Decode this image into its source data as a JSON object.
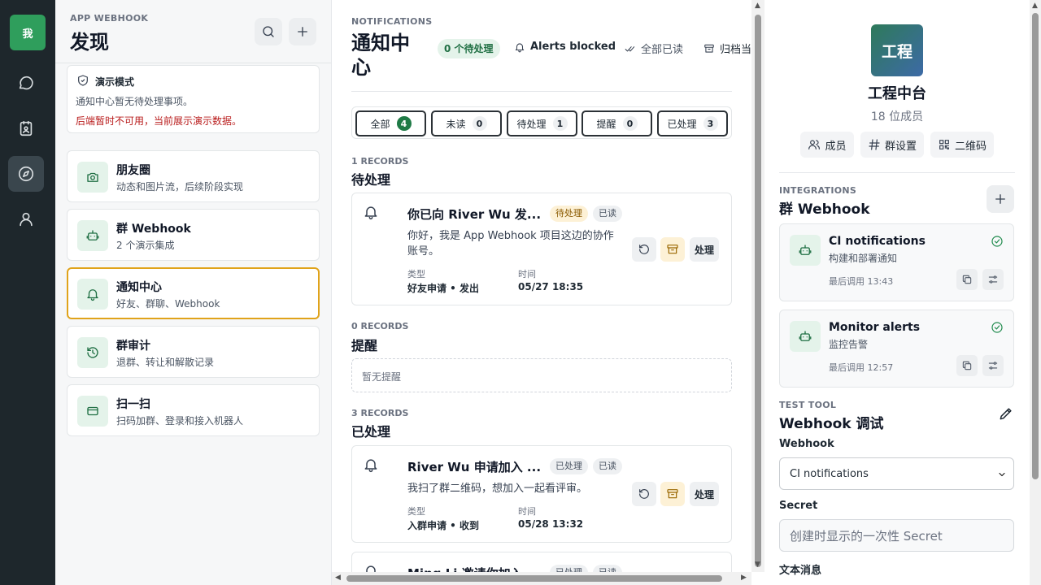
{
  "rail": {
    "me_label": "我"
  },
  "sidebar": {
    "eyebrow": "APP WEBHOOK",
    "title": "发现",
    "demo": {
      "title": "演示模式",
      "line1": "通知中心暂无待处理事项。",
      "line2": "后端暂时不可用，当前展示演示数据。"
    },
    "items": [
      {
        "title": "朋友圈",
        "subtitle": "动态和图片流，后续阶段实现"
      },
      {
        "title": "群 Webhook",
        "subtitle": "2 个演示集成"
      },
      {
        "title": "通知中心",
        "subtitle": "好友、群聊、Webhook"
      },
      {
        "title": "群审计",
        "subtitle": "退群、转让和解散记录"
      },
      {
        "title": "扫一扫",
        "subtitle": "扫码加群、登录和接入机器人"
      }
    ]
  },
  "main": {
    "eyebrow": "NOTIFICATIONS",
    "title": "通知中心",
    "pending_pill": "0 个待处理",
    "alerts_blocked": "Alerts blocked",
    "mark_all_read": "全部已读",
    "archive": "归档当前",
    "tabs": [
      {
        "label": "全部",
        "count": "4"
      },
      {
        "label": "未读",
        "count": "0"
      },
      {
        "label": "待处理",
        "count": "1"
      },
      {
        "label": "提醒",
        "count": "0"
      },
      {
        "label": "已处理",
        "count": "3"
      }
    ],
    "sections": [
      {
        "records": "1 RECORDS",
        "title": "待处理"
      },
      {
        "records": "0 RECORDS",
        "title": "提醒",
        "empty": "暂无提醒"
      },
      {
        "records": "3 RECORDS",
        "title": "已处理"
      }
    ],
    "notifications": [
      {
        "title": "你已向 River Wu 发...",
        "badge1": "待处理",
        "badge2": "已读",
        "body": "你好，我是 App Webhook 项目这边的协作账号。",
        "type_label": "类型",
        "type_value": "好友申请 • 发出",
        "time_label": "时间",
        "time_value": "05/27 18:35",
        "action": "处理"
      },
      {
        "title": "River Wu 申请加入 ...",
        "badge1": "已处理",
        "badge2": "已读",
        "body": "我扫了群二维码，想加入一起看评审。",
        "type_label": "类型",
        "type_value": "入群申请 • 收到",
        "time_label": "时间",
        "time_value": "05/28 13:32",
        "action": "处理"
      },
      {
        "title": "Ming Li 邀请你加入 ...",
        "badge1": "已处理",
        "badge2": "已读"
      }
    ]
  },
  "group": {
    "logo": "工程",
    "name": "工程中台",
    "members": "18 位成员",
    "buttons": [
      "成员",
      "群设置",
      "二维码"
    ],
    "integrations_eyebrow": "INTEGRATIONS",
    "integrations_title": "群 Webhook",
    "webhooks": [
      {
        "name": "CI notifications",
        "desc": "构建和部署通知",
        "last": "最后调用 13:43"
      },
      {
        "name": "Monitor alerts",
        "desc": "监控告警",
        "last": "最后调用 12:57"
      }
    ],
    "test_eyebrow": "TEST TOOL",
    "test_title": "Webhook 调试",
    "webhook_label": "Webhook",
    "webhook_selected": "CI notifications",
    "secret_label": "Secret",
    "secret_placeholder": "创建时显示的一次性 Secret",
    "text_label": "文本消息"
  },
  "colors": {
    "rail": "#1e272c",
    "accent_green": "#1f7a46",
    "active_border": "#e0a31a",
    "warning_text": "#b91c1c"
  },
  "icons": [
    "chat-icon",
    "calendar-icon",
    "compass-icon",
    "user-icon",
    "search-icon",
    "plus-icon",
    "shield-icon",
    "camera-icon",
    "robot-icon",
    "bell-icon",
    "history-icon",
    "scan-card-icon",
    "undo-icon",
    "archive-icon",
    "check-circle-icon",
    "copy-icon",
    "settings-sliders-icon",
    "edit-icon",
    "qrcode-icon",
    "hash-icon",
    "users-icon",
    "double-check-icon",
    "chevron-down-icon"
  ]
}
